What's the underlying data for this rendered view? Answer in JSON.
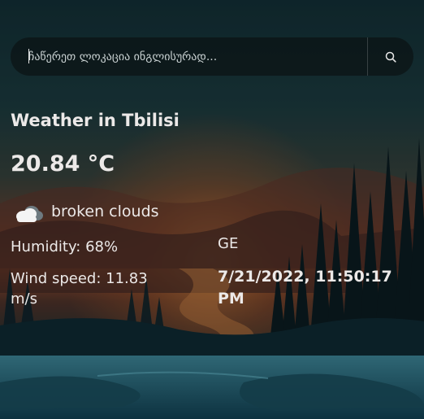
{
  "search": {
    "placeholder": "ჩაწერეთ ლოკაცია ინგლისურად...",
    "icon": "search-icon"
  },
  "weather": {
    "title": "Weather in Tbilisi",
    "temperature": "20.84 °C",
    "condition_icon": "cloud-icon",
    "condition": "broken clouds",
    "humidity": "Humidity: 68%",
    "wind": "Wind speed: 11.83 m/s",
    "country": "GE",
    "datetime": "7/21/2022, 11:50:17 PM"
  },
  "colors": {
    "text": "#ece9e8",
    "card_overlay": "rgba(0,0,0,0.32)",
    "search_bg": "rgba(12,20,22,0.78)"
  }
}
